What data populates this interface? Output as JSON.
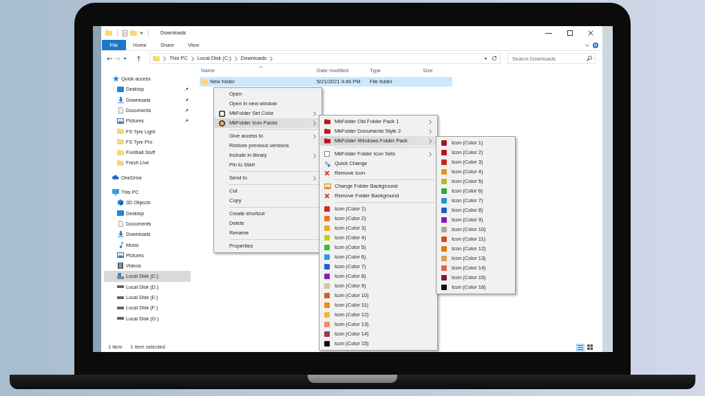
{
  "window": {
    "title": "Downloads"
  },
  "ribbon": {
    "tabs": [
      {
        "label": "File",
        "kind": "backstage"
      },
      {
        "label": "Home",
        "kind": "tab"
      },
      {
        "label": "Share",
        "kind": "tab"
      },
      {
        "label": "View",
        "kind": "tab"
      }
    ]
  },
  "address_bar": {
    "path": [
      "This PC",
      "Local Disk (C:)",
      "Downloads"
    ]
  },
  "search": {
    "placeholder": "Search Downloads"
  },
  "sidebar": {
    "items": [
      {
        "label": "Quick access",
        "kind": "star",
        "selected": false,
        "children": [
          {
            "label": "Desktop",
            "kind": "desktop",
            "pinned": true,
            "selected": false
          },
          {
            "label": "Downloads",
            "kind": "download",
            "pinned": true,
            "selected": false
          },
          {
            "label": "Documents",
            "kind": "documents",
            "pinned": true,
            "selected": false
          },
          {
            "label": "Pictures",
            "kind": "pictures",
            "pinned": true,
            "selected": false
          },
          {
            "label": "FS Tyre Light",
            "kind": "folder",
            "pinned": false,
            "selected": false
          },
          {
            "label": "FS Tyre Pro",
            "kind": "folder",
            "pinned": false,
            "selected": false
          },
          {
            "label": "Football Stuff",
            "kind": "folder",
            "pinned": false,
            "selected": false
          },
          {
            "label": "Fresh Live",
            "kind": "folder",
            "pinned": false,
            "selected": false
          }
        ]
      },
      {
        "label": "OneDrive",
        "kind": "cloud",
        "selected": false
      },
      {
        "label": "This PC",
        "kind": "pc",
        "selected": false,
        "children": [
          {
            "label": "3D Objects",
            "kind": "cube",
            "selected": false
          },
          {
            "label": "Desktop",
            "kind": "desktop",
            "selected": false
          },
          {
            "label": "Documents",
            "kind": "documents",
            "selected": false
          },
          {
            "label": "Downloads",
            "kind": "download",
            "selected": false
          },
          {
            "label": "Music",
            "kind": "music",
            "selected": false
          },
          {
            "label": "Pictures",
            "kind": "pictures",
            "selected": false
          },
          {
            "label": "Videos",
            "kind": "videos",
            "selected": false
          },
          {
            "label": "Local Disk (C:)",
            "kind": "sysdrive",
            "selected": true
          },
          {
            "label": "Local Disk (D:)",
            "kind": "drive",
            "selected": false
          },
          {
            "label": "Local Disk (E:)",
            "kind": "drive",
            "selected": false
          },
          {
            "label": "Local Disk (F:)",
            "kind": "drive",
            "selected": false
          },
          {
            "label": "Local Disk (G:)",
            "kind": "drive",
            "selected": false
          }
        ]
      }
    ]
  },
  "table": {
    "columns": [
      {
        "label": "Name",
        "sorted": true
      },
      {
        "label": "Date modified",
        "sorted": false
      },
      {
        "label": "Type",
        "sorted": false
      },
      {
        "label": "Size",
        "sorted": false
      }
    ],
    "rows": [
      {
        "name": "New folder",
        "date_modified": "5/21/2021 4:46 PM",
        "type": "File folder",
        "selected": true
      }
    ]
  },
  "context_menu": {
    "items": [
      {
        "kind": "plain",
        "label": "Open",
        "submenu": false,
        "selected": false
      },
      {
        "kind": "plain",
        "label": "Open in new window",
        "submenu": false,
        "selected": false
      },
      {
        "kind": "square",
        "label": "MkFolder Set Color",
        "submenu": true,
        "selected": false
      },
      {
        "kind": "ring",
        "label": "MkFolder Icon Packs",
        "submenu": true,
        "selected": true
      },
      {
        "kind": "separator"
      },
      {
        "kind": "plain",
        "label": "Give access to",
        "submenu": true,
        "selected": false
      },
      {
        "kind": "plain",
        "label": "Restore previous versions",
        "submenu": false,
        "selected": false
      },
      {
        "kind": "plain",
        "label": "Include in library",
        "submenu": true,
        "selected": false
      },
      {
        "kind": "plain",
        "label": "Pin to Start",
        "submenu": false,
        "selected": false
      },
      {
        "kind": "separator"
      },
      {
        "kind": "plain",
        "label": "Send to",
        "submenu": true,
        "selected": false
      },
      {
        "kind": "separator"
      },
      {
        "kind": "plain",
        "label": "Cut",
        "submenu": false,
        "selected": false
      },
      {
        "kind": "plain",
        "label": "Copy",
        "submenu": false,
        "selected": false
      },
      {
        "kind": "separator"
      },
      {
        "kind": "plain",
        "label": "Create shortcut",
        "submenu": false,
        "selected": false
      },
      {
        "kind": "plain",
        "label": "Delete",
        "submenu": false,
        "selected": false
      },
      {
        "kind": "plain",
        "label": "Rename",
        "submenu": false,
        "selected": false
      },
      {
        "kind": "separator"
      },
      {
        "kind": "plain",
        "label": "Properties",
        "submenu": false,
        "selected": false
      }
    ]
  },
  "submenu": {
    "items": [
      {
        "kind": "pack",
        "label": "MkFolder Old Folder Pack 1",
        "submenu": true,
        "selected": false
      },
      {
        "kind": "pack",
        "label": "MkFolder Documents Style 2",
        "submenu": true,
        "selected": false
      },
      {
        "kind": "pack",
        "label": "MkFolder Windows Folder Pack",
        "submenu": true,
        "selected": true
      },
      {
        "kind": "separator"
      },
      {
        "kind": "outline",
        "label": "MkFolder Folder Icon Sets",
        "submenu": true,
        "selected": false
      },
      {
        "kind": "brush",
        "label": "Quick Change",
        "submenu": false,
        "selected": false
      },
      {
        "kind": "cross",
        "label": "Remove Icon",
        "submenu": false,
        "selected": false
      },
      {
        "kind": "separator"
      },
      {
        "kind": "image",
        "label": "Change Folder Background",
        "submenu": false,
        "selected": false
      },
      {
        "kind": "cross",
        "label": "Remove Folder Background",
        "submenu": false,
        "selected": false
      },
      {
        "kind": "separator"
      },
      {
        "kind": "swatch",
        "label": "Icon (Color 1)",
        "color": "#d32a1e",
        "submenu": false,
        "selected": false
      },
      {
        "kind": "swatch",
        "label": "Icon (Color 2)",
        "color": "#e8761c",
        "submenu": false,
        "selected": false
      },
      {
        "kind": "swatch",
        "label": "Icon (Color 3)",
        "color": "#f2a81d",
        "submenu": false,
        "selected": false
      },
      {
        "kind": "swatch",
        "label": "Icon (Color 4)",
        "color": "#b9d41a",
        "submenu": false,
        "selected": false
      },
      {
        "kind": "swatch",
        "label": "Icon (Color 5)",
        "color": "#36c22b",
        "submenu": false,
        "selected": false
      },
      {
        "kind": "swatch",
        "label": "Icon (Color 6)",
        "color": "#2e9bdc",
        "submenu": false,
        "selected": false
      },
      {
        "kind": "swatch",
        "label": "Icon (Color 7)",
        "color": "#1c64c8",
        "submenu": false,
        "selected": false
      },
      {
        "kind": "swatch",
        "label": "Icon (Color 8)",
        "color": "#8e1fb8",
        "submenu": false,
        "selected": false
      },
      {
        "kind": "swatch",
        "label": "Icon (Color 9)",
        "color": "#d9c3a8",
        "submenu": false,
        "selected": false
      },
      {
        "kind": "swatch",
        "label": "Icon (Color 10)",
        "color": "#cf6421",
        "submenu": false,
        "selected": false
      },
      {
        "kind": "swatch",
        "label": "Icon (Color 11)",
        "color": "#f08a1a",
        "submenu": false,
        "selected": false
      },
      {
        "kind": "swatch",
        "label": "Icon (Color 12)",
        "color": "#f3b63a",
        "submenu": false,
        "selected": false
      },
      {
        "kind": "swatch",
        "label": "Icon (Color 13)",
        "color": "#ef8a6a",
        "submenu": false,
        "selected": false
      },
      {
        "kind": "swatch",
        "label": "Icon (Color 14)",
        "color": "#a8324a",
        "submenu": false,
        "selected": false
      },
      {
        "kind": "swatch",
        "label": "Icon (Color 15)",
        "color": "#111111",
        "submenu": false,
        "selected": false
      }
    ]
  },
  "color_submenu": {
    "items": [
      {
        "kind": "swatch",
        "label": "Icon (Color 1)",
        "color": "#a3171f",
        "submenu": false,
        "selected": false
      },
      {
        "kind": "swatch",
        "label": "Icon (Color 2)",
        "color": "#b5141c",
        "submenu": false,
        "selected": false
      },
      {
        "kind": "swatch",
        "label": "Icon (Color 3)",
        "color": "#c0281e",
        "submenu": false,
        "selected": false
      },
      {
        "kind": "swatch",
        "label": "Icon (Color 4)",
        "color": "#e8901e",
        "submenu": false,
        "selected": false
      },
      {
        "kind": "swatch",
        "label": "Icon (Color 5)",
        "color": "#a6c21e",
        "submenu": false,
        "selected": false
      },
      {
        "kind": "swatch",
        "label": "Icon (Color 6)",
        "color": "#2eaa2e",
        "submenu": false,
        "selected": false
      },
      {
        "kind": "swatch",
        "label": "Icon (Color 7)",
        "color": "#2b8fd0",
        "submenu": false,
        "selected": false
      },
      {
        "kind": "swatch",
        "label": "Icon (Color 8)",
        "color": "#1d5fbf",
        "submenu": false,
        "selected": false
      },
      {
        "kind": "swatch",
        "label": "Icon (Color 9)",
        "color": "#7b1fb0",
        "submenu": false,
        "selected": false
      },
      {
        "kind": "swatch",
        "label": "Icon (Color 10)",
        "color": "#b8a496",
        "submenu": false,
        "selected": false
      },
      {
        "kind": "swatch",
        "label": "Icon (Color 11)",
        "color": "#c45a1c",
        "submenu": false,
        "selected": false
      },
      {
        "kind": "swatch",
        "label": "Icon (Color 12)",
        "color": "#d97a18",
        "submenu": false,
        "selected": false
      },
      {
        "kind": "swatch",
        "label": "Icon (Color 13)",
        "color": "#e59a4a",
        "submenu": false,
        "selected": false
      },
      {
        "kind": "swatch",
        "label": "Icon (Color 14)",
        "color": "#d9674d",
        "submenu": false,
        "selected": false
      },
      {
        "kind": "swatch",
        "label": "Icon (Color 15)",
        "color": "#7d1838",
        "submenu": false,
        "selected": false
      },
      {
        "kind": "swatch",
        "label": "Icon (Color 16)",
        "color": "#0a0a0a",
        "submenu": false,
        "selected": false
      }
    ]
  },
  "status_bar": {
    "item_count": "1 item",
    "selection": "1 item selected",
    "views": [
      {
        "kind": "details",
        "selected": true
      },
      {
        "kind": "tiles",
        "selected": false
      }
    ]
  }
}
